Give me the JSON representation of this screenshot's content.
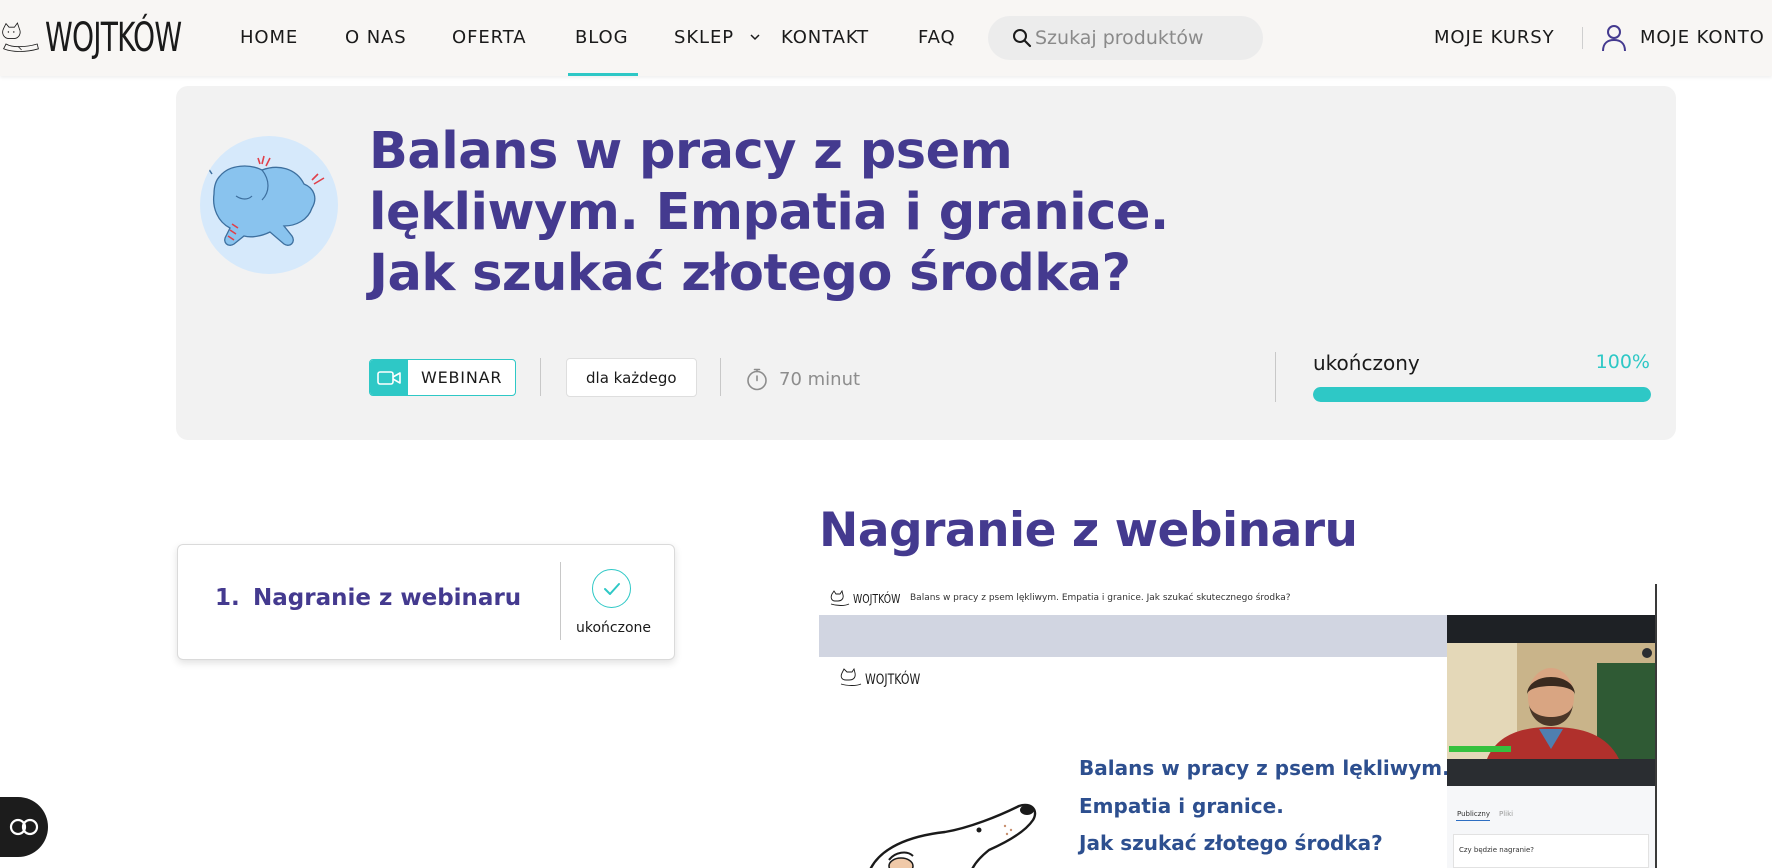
{
  "nav": {
    "logo_text": "WOJTKÓW",
    "items": [
      {
        "label": "HOME"
      },
      {
        "label": "O NAS"
      },
      {
        "label": "OFERTA"
      },
      {
        "label": "BLOG"
      },
      {
        "label": "SKLEP"
      },
      {
        "label": "KONTAKT"
      },
      {
        "label": "FAQ"
      }
    ],
    "active_item": "BLOG",
    "search_placeholder": "Szukaj produktów",
    "my_courses": "MOJE KURSY",
    "my_account": "MOJE KONTO"
  },
  "course": {
    "title": "Balans w pracy z psem lękliwym. Empatia i granice. Jak szukać złotego środka?",
    "type_label": "WEBINAR",
    "level_label": "dla każdego",
    "duration": "70 minut",
    "progress_label": "ukończony",
    "progress_text": "100%",
    "progress_value": 1.0
  },
  "lessons": [
    {
      "number": "1.",
      "title": "Nagranie z webinaru",
      "status": "ukończone"
    }
  ],
  "section": {
    "title": "Nagranie z webinaru"
  },
  "video": {
    "logo_text": "WOJTKÓW",
    "top_title": "Balans w pracy z psem lękliwym. Empatia i granice. Jak szukać skutecznego środka?",
    "slide_title_lines": [
      "Balans w pracy z psem lękliwym.",
      "Empatia i granice.",
      "Jak szukać złotego środka?"
    ],
    "tabs": [
      "Publiczny",
      "Pliki"
    ],
    "chat_message": "Czy będzie nagranie?"
  },
  "colors": {
    "brand_purple": "#443a8f",
    "accent_teal": "#2ec8c6",
    "hero_bg": "#f2f2f2",
    "nav_bg": "#f8f6f4"
  },
  "icons": {
    "search": "search-icon",
    "user": "user-icon",
    "webinar": "video-camera-icon",
    "duration": "stopwatch-icon",
    "check": "check-circle-icon",
    "chat": "chat-icon"
  }
}
